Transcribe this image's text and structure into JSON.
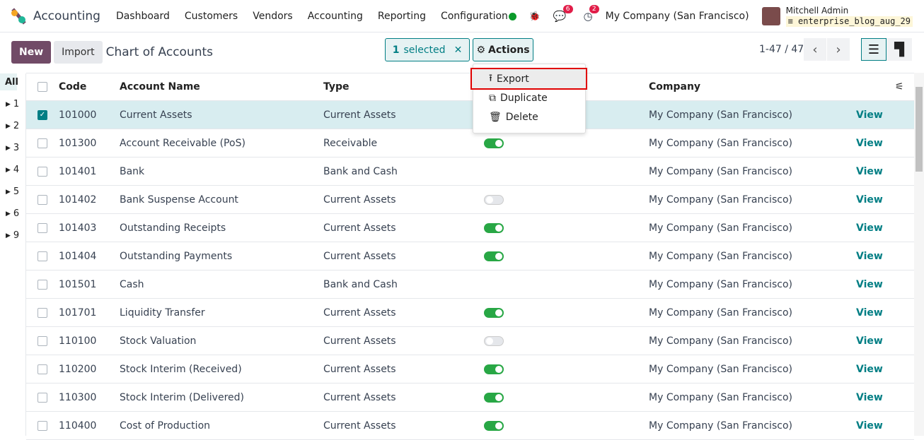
{
  "nav": {
    "app": "Accounting",
    "menus": [
      "Dashboard",
      "Customers",
      "Vendors",
      "Accounting",
      "Reporting",
      "Configuration"
    ],
    "messages_count": "6",
    "activities_count": "2",
    "company": "My Company (San Francisco)",
    "user": "Mitchell Admin",
    "database": "enterprise_blog_aug_29"
  },
  "cp": {
    "new": "New",
    "import": "Import",
    "title": "Chart of Accounts",
    "selected_count": "1",
    "selected_label": "selected",
    "actions": "Actions",
    "pager": "1-47 / 47"
  },
  "dropdown": {
    "items": [
      "Export",
      "Duplicate",
      "Delete"
    ]
  },
  "sidebar": [
    "All",
    "1",
    "2",
    "3",
    "4",
    "5",
    "6",
    "9"
  ],
  "table": {
    "headers": {
      "code": "Code",
      "name": "Account Name",
      "type": "Type",
      "company": "Company"
    },
    "rows": [
      {
        "code": "101000",
        "name": "Current Assets",
        "type": "Current Assets",
        "toggle": null,
        "company": "My Company (San Francisco)",
        "link": "View",
        "selected": true
      },
      {
        "code": "101300",
        "name": "Account Receivable (PoS)",
        "type": "Receivable",
        "toggle": true,
        "company": "My Company (San Francisco)",
        "link": "View"
      },
      {
        "code": "101401",
        "name": "Bank",
        "type": "Bank and Cash",
        "toggle": null,
        "company": "My Company (San Francisco)",
        "link": "View"
      },
      {
        "code": "101402",
        "name": "Bank Suspense Account",
        "type": "Current Assets",
        "toggle": false,
        "company": "My Company (San Francisco)",
        "link": "View"
      },
      {
        "code": "101403",
        "name": "Outstanding Receipts",
        "type": "Current Assets",
        "toggle": true,
        "company": "My Company (San Francisco)",
        "link": "View"
      },
      {
        "code": "101404",
        "name": "Outstanding Payments",
        "type": "Current Assets",
        "toggle": true,
        "company": "My Company (San Francisco)",
        "link": "View"
      },
      {
        "code": "101501",
        "name": "Cash",
        "type": "Bank and Cash",
        "toggle": null,
        "company": "My Company (San Francisco)",
        "link": "View"
      },
      {
        "code": "101701",
        "name": "Liquidity Transfer",
        "type": "Current Assets",
        "toggle": true,
        "company": "My Company (San Francisco)",
        "link": "View"
      },
      {
        "code": "110100",
        "name": "Stock Valuation",
        "type": "Current Assets",
        "toggle": false,
        "company": "My Company (San Francisco)",
        "link": "View"
      },
      {
        "code": "110200",
        "name": "Stock Interim (Received)",
        "type": "Current Assets",
        "toggle": true,
        "company": "My Company (San Francisco)",
        "link": "View"
      },
      {
        "code": "110300",
        "name": "Stock Interim (Delivered)",
        "type": "Current Assets",
        "toggle": true,
        "company": "My Company (San Francisco)",
        "link": "View"
      },
      {
        "code": "110400",
        "name": "Cost of Production",
        "type": "Current Assets",
        "toggle": true,
        "company": "My Company (San Francisco)",
        "link": "View"
      }
    ]
  },
  "colors": {
    "primary": "#714b67",
    "accent": "#017e84",
    "toggle_on": "#28a745",
    "highlight": "#e00000"
  }
}
